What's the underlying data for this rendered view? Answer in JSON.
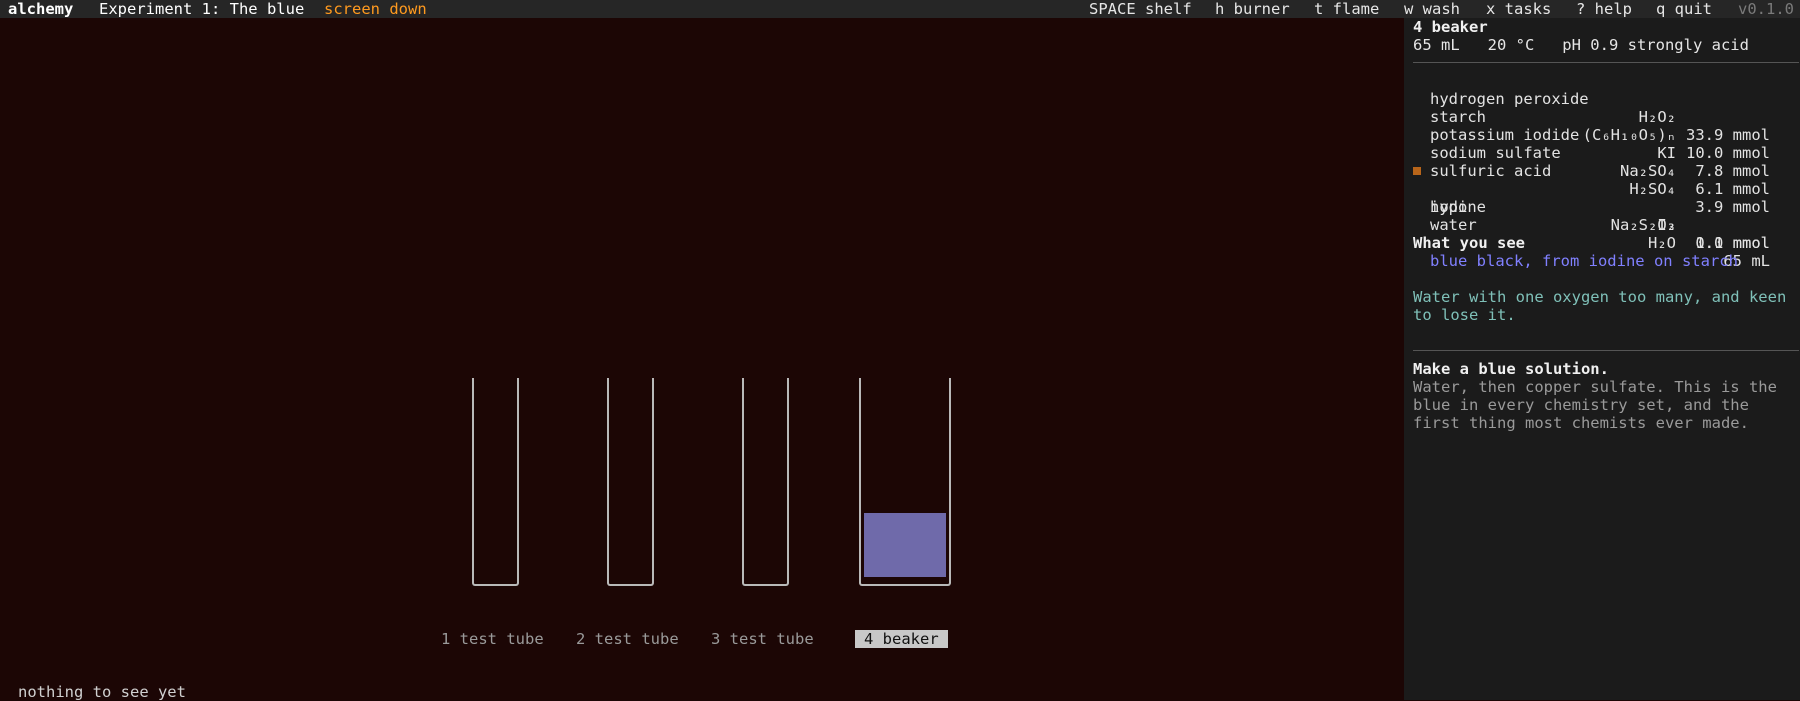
{
  "topbar": {
    "app_name": "alchemy",
    "experiment": "Experiment 1: The blue",
    "status": "screen down",
    "keys": [
      {
        "label": "SPACE shelf"
      },
      {
        "label": "h burner"
      },
      {
        "label": "t flame"
      },
      {
        "label": "w wash"
      },
      {
        "label": "x tasks"
      },
      {
        "label": "? help"
      },
      {
        "label": "q quit"
      }
    ],
    "version": "v0.1.0"
  },
  "scene": {
    "vessels": [
      {
        "label": "1 test tube",
        "fill_fraction": 0
      },
      {
        "label": "2 test tube",
        "fill_fraction": 0
      },
      {
        "label": "3 test tube",
        "fill_fraction": 0
      },
      {
        "label": "4 beaker",
        "fill_fraction": 0.35,
        "selected": true
      }
    ],
    "liquid_color": "#6f6aaa",
    "hint": "nothing to see yet"
  },
  "panel": {
    "title": "4 beaker",
    "stats": "65 mL   20 °C   pH 0.9 strongly acid",
    "chemicals": [
      {
        "name": "hydrogen peroxide",
        "formula": "H₂O₂",
        "amount": "33.9 mmol"
      },
      {
        "name": "starch",
        "formula": "(C₆H₁₀O₅)ₙ",
        "amount": "10.0 mmol"
      },
      {
        "name": "potassium iodide",
        "formula": "KI",
        "amount": "7.8 mmol"
      },
      {
        "name": "sodium sulfate",
        "formula": "Na₂SO₄",
        "amount": "6.1 mmol"
      },
      {
        "name": "sulfuric acid",
        "formula": "H₂SO₄",
        "amount": "3.9 mmol"
      },
      {
        "name": "iodine",
        "formula": "I₂",
        "amount": "1.1 mmol",
        "marked": true
      },
      {
        "name": "hypo",
        "formula": "Na₂S₂O₃",
        "amount": "0.0 mmol"
      },
      {
        "name": "water",
        "formula": "H₂O",
        "amount": "65 mL"
      }
    ],
    "marker_color": "#b8651a",
    "see_heading": "What you see",
    "see_text": "blue black, from iodine on starch",
    "description": "Water with one oxygen too many, and keen\nto lose it.",
    "task_heading": "Make a blue solution.",
    "task_text": "Water, then copper sulfate. This is the\nblue in every chemistry set, and the\nfirst thing most chemists ever made."
  }
}
